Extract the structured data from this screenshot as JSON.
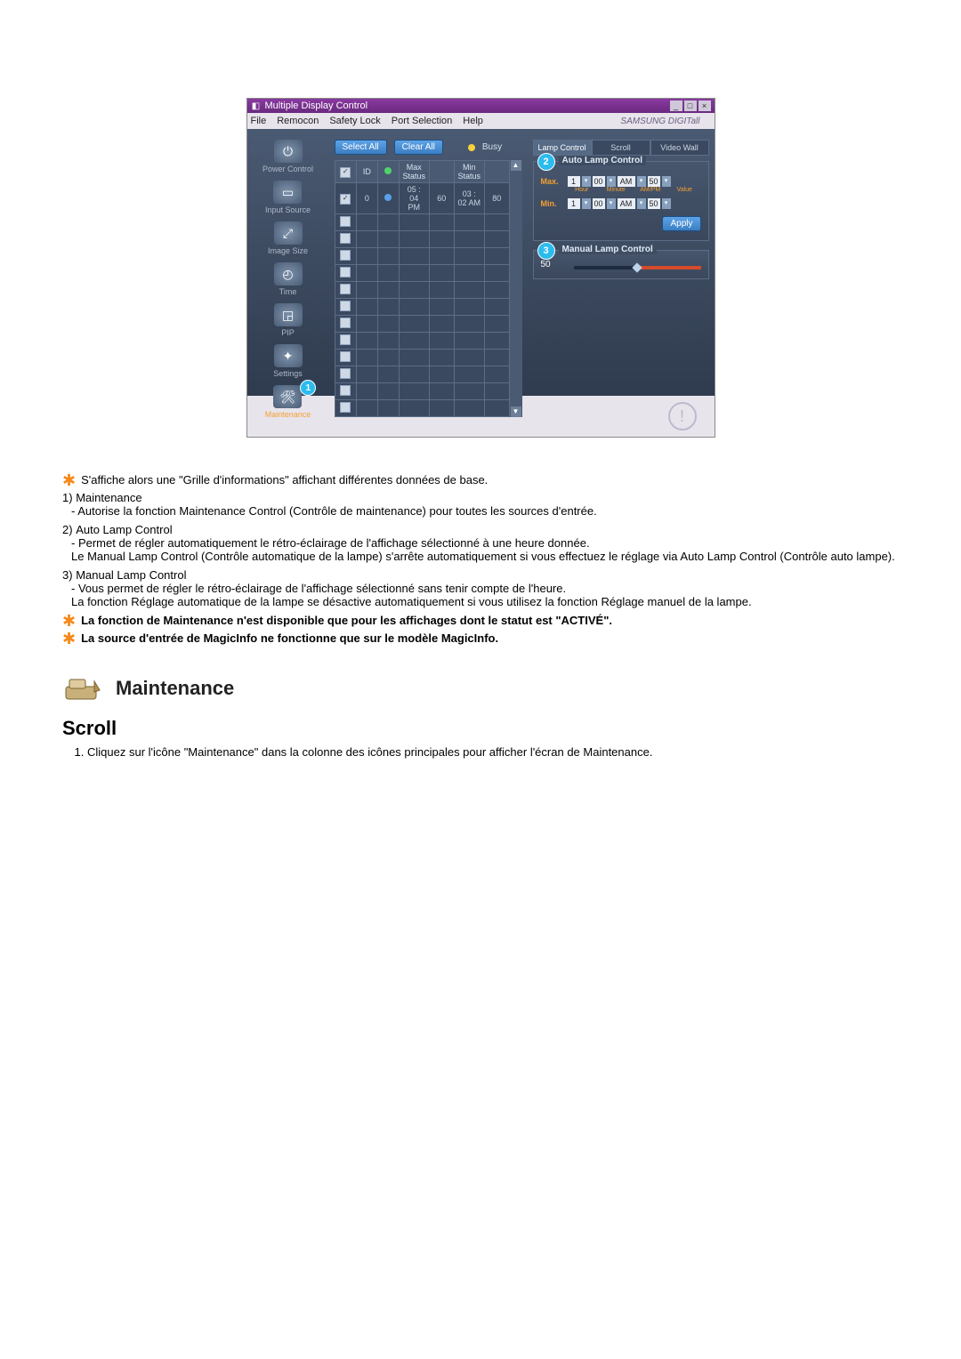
{
  "app": {
    "title": "Multiple Display Control",
    "brand": "SAMSUNG DIGITall"
  },
  "menu": {
    "file": "File",
    "remocon": "Remocon",
    "safety_lock": "Safety Lock",
    "port_selection": "Port Selection",
    "help": "Help"
  },
  "sidebar": {
    "items": [
      {
        "label": "Power Control"
      },
      {
        "label": "Input Source"
      },
      {
        "label": "Image Size"
      },
      {
        "label": "Time"
      },
      {
        "label": "PIP"
      },
      {
        "label": "Settings"
      },
      {
        "label": "Maintenance"
      }
    ],
    "badge1": "1"
  },
  "toolbar": {
    "select_all": "Select All",
    "clear_all": "Clear All",
    "busy": "Busy"
  },
  "grid": {
    "headers": {
      "chk": "",
      "id": "ID",
      "lamp": "",
      "max_status": "Max Status",
      "max_val": "",
      "min_status": "Min Status",
      "min_val": ""
    },
    "row": {
      "id": "0",
      "max_status": "05 : 04 PM",
      "max_val": "60",
      "min_status": "03 : 02 AM",
      "min_val": "80"
    }
  },
  "tabs": {
    "lamp_control": "Lamp Control",
    "scroll": "Scroll",
    "video_wall": "Video Wall"
  },
  "auto": {
    "badge": "2",
    "title": "Auto Lamp Control",
    "max_label": "Max.",
    "min_label": "Min.",
    "hour": "1",
    "minute": "00",
    "ampm": "AM",
    "value": "50",
    "sub": {
      "hour": "Hour",
      "minute": "Minute",
      "ampm": "AM/PM",
      "value": "Value"
    },
    "apply": "Apply"
  },
  "manual": {
    "badge": "3",
    "title": "Manual Lamp Control",
    "value": "50"
  },
  "doc": {
    "p_info_grid": "S'affiche alors une \"Grille d'informations\" affichant différentes données de base.",
    "items": [
      {
        "num": "1)",
        "head": "Maintenance",
        "body": "- Autorise la fonction Maintenance Control (Contrôle de maintenance) pour toutes les sources d'entrée."
      },
      {
        "num": "2)",
        "head": "Auto Lamp Control",
        "body": "- Permet de régler automatiquement le rétro-éclairage de l'affichage sélectionné à une heure donnée.\nLe Manual Lamp Control (Contrôle automatique de la lampe) s'arrête automatiquement si vous effectuez le réglage via Auto Lamp Control (Contrôle auto lampe)."
      },
      {
        "num": "3)",
        "head": "Manual Lamp Control",
        "body": "- Vous permet de régler le rétro-éclairage de l'affichage sélectionné sans tenir compte de l'heure.\nLa fonction Réglage automatique de la lampe se désactive automatiquement si vous utilisez la fonction Réglage manuel de la lampe."
      }
    ],
    "warn1": "La fonction de Maintenance n'est disponible que pour les affichages dont le statut est \"ACTIVÉ\".",
    "warn2": "La source d'entrée de MagicInfo ne fonctionne que sur le modèle MagicInfo.",
    "section_title": "Maintenance",
    "section_sub": "Scroll",
    "step1": "Cliquez sur l'icône \"Maintenance\" dans la colonne des icônes principales pour afficher l'écran de Maintenance."
  }
}
